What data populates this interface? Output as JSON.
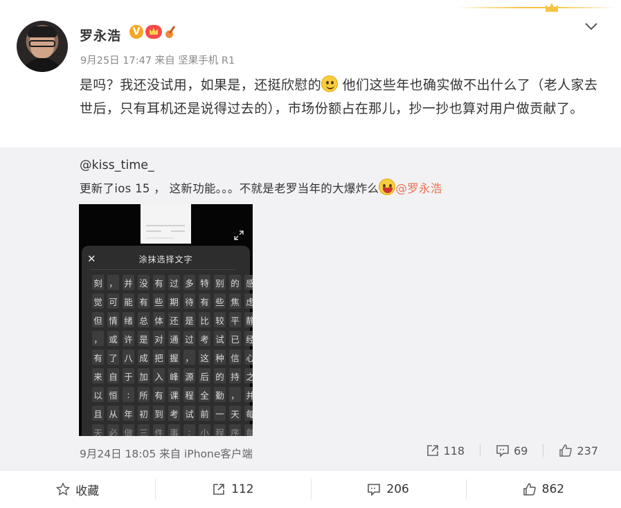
{
  "post": {
    "username": "罗永浩",
    "verified_badge": "V",
    "time": "9月25日 17:47",
    "source": "来自 坚果手机 R1",
    "text_part1": "是吗？我还没试用，如果是，还挺欣慰的",
    "text_part2": " 他们这些年也确实做不出什么了（老人家去世后，只有耳机还是说得过去的），市场份额占在那儿，抄一抄也算对用户做贡献了。"
  },
  "repost": {
    "username": "@kiss_time_",
    "text": "更新了ios 15 ， 这新功能。。。不就是老罗当年的大爆炸么",
    "mention": "@罗永浩",
    "time": "9月24日 18:05",
    "source": "来自 iPhone客户端",
    "forward_count": "118",
    "comment_count": "69",
    "like_count": "237",
    "image": {
      "sheet_title": "涂抹选择文字",
      "close_glyph": "✕",
      "rows": [
        [
          "刻",
          "，",
          "并",
          "没",
          "有",
          "过",
          "多",
          "特",
          "别",
          "的",
          "感"
        ],
        [
          "觉",
          "可",
          "能",
          "有",
          "些",
          "期",
          "待",
          "有",
          "些",
          "焦",
          "虑"
        ],
        [
          "但",
          "情",
          "绪",
          "总",
          "体",
          "还",
          "是",
          "比",
          "较",
          "平",
          "静"
        ],
        [
          "，",
          "或",
          "许",
          "是",
          "对",
          "通",
          "过",
          "考",
          "试",
          "已",
          "经"
        ],
        [
          "有",
          "了",
          "八",
          "成",
          "把",
          "握",
          "，",
          "这",
          "种",
          "信",
          "心"
        ],
        [
          "来",
          "自",
          "于",
          "加",
          "入",
          "峰",
          "源",
          "后",
          "的",
          "持",
          "之"
        ],
        [
          "以",
          "恒",
          ":",
          "所",
          "有",
          "课",
          "程",
          "全",
          "勤",
          "，",
          "并"
        ],
        [
          "且",
          "从",
          "年",
          "初",
          "到",
          "考",
          "试",
          "前",
          "一",
          "天",
          "每"
        ],
        [
          "天",
          "必",
          "做",
          "三",
          "件",
          "事",
          ":",
          "小",
          "程",
          "序",
          "每"
        ]
      ]
    }
  },
  "footer": {
    "favorite_label": "收藏",
    "forward_count": "112",
    "comment_count": "206",
    "like_count": "862"
  },
  "colors": {
    "mention": "#eb7350",
    "repost_bg": "#f2f2f5",
    "badge_v": "#f5a623"
  },
  "icons": [
    "crown-icon",
    "chevron-down-icon",
    "verified-v-icon",
    "vip-crown-icon",
    "guitar-icon",
    "smile-emoji-icon",
    "laugh-emoji-icon",
    "expand-icon",
    "forward-icon",
    "comment-icon",
    "like-icon",
    "star-icon"
  ]
}
